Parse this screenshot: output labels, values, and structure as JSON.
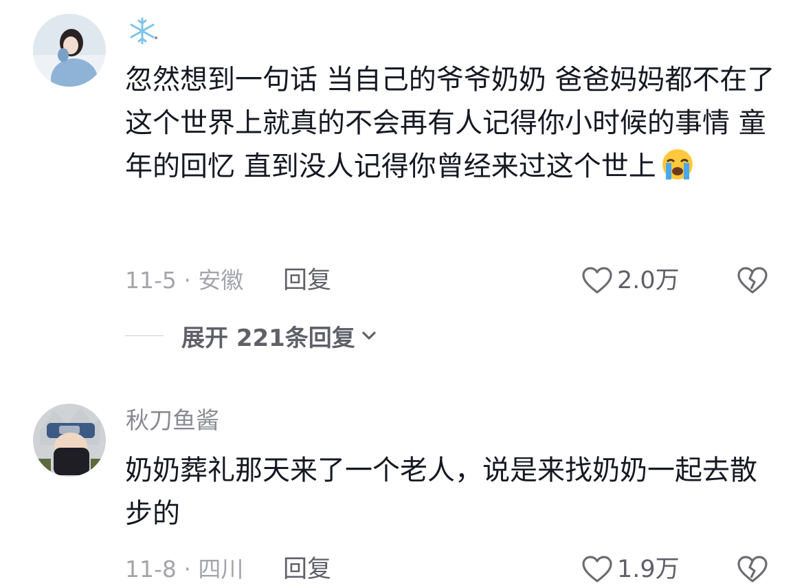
{
  "comments": [
    {
      "username": "❄️ .",
      "content": "忽然想到一句话 当自己的爷爷奶奶 爸爸妈妈都不在了 这个世界上就真的不会再有人记得你小时候的事情 童年的回忆 直到没人记得你曾经来过这个世上",
      "emoji": "loudly-crying-face-icon",
      "date_location": "11-5 · 安徽",
      "reply_label": "回复",
      "likes": "2.0万",
      "expand_label": "展开 221条回复"
    },
    {
      "username": "秋刀鱼酱",
      "content": "奶奶葬礼那天来了一个老人，说是来找奶奶一起去散步的",
      "date_location": "11-8 · 四川",
      "reply_label": "回复",
      "likes": "1.9万"
    }
  ],
  "colors": {
    "text": "#161823",
    "secondary": "#8a8b91",
    "meta": "#a4a5aa",
    "action": "#5f6068"
  }
}
